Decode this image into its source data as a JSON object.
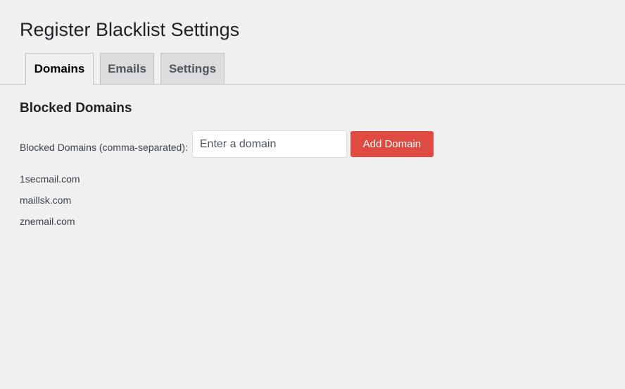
{
  "page": {
    "title": "Register Blacklist Settings"
  },
  "tabs": [
    {
      "label": "Domains",
      "active": true
    },
    {
      "label": "Emails",
      "active": false
    },
    {
      "label": "Settings",
      "active": false
    }
  ],
  "section": {
    "title": "Blocked Domains",
    "field_label": "Blocked Domains (comma-separated):",
    "input_value": "",
    "input_placeholder": "Enter a domain",
    "add_button_label": "Add Domain",
    "add_button_color": "#e04b41"
  },
  "domains": [
    "1secmail.com",
    "maillsk.com",
    "znemail.com"
  ]
}
